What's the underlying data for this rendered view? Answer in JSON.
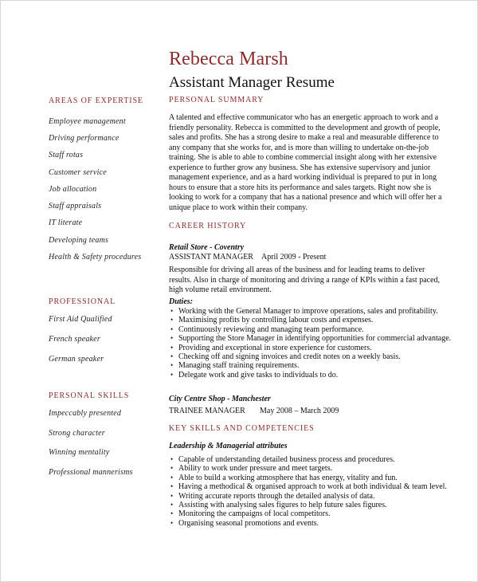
{
  "header": {
    "name": "Rebecca Marsh",
    "subtitle": "Assistant Manager Resume"
  },
  "sidebar": {
    "expertise": {
      "heading": "AREAS OF EXPERTISE",
      "items": [
        "Employee management",
        "Driving performance",
        "Staff rotas",
        "Customer service",
        "Job allocation",
        "Staff appraisals",
        "IT literate",
        "Developing teams",
        "Health & Safety procedures"
      ]
    },
    "professional": {
      "heading": "PROFESSIONAL",
      "items": [
        "First Aid Qualified",
        "French speaker",
        "German speaker"
      ]
    },
    "personal_skills": {
      "heading": "PERSONAL SKILLS",
      "items": [
        "Impeccably presented",
        "Strong character",
        "Winning mentality",
        "Professional mannerisms"
      ]
    }
  },
  "summary": {
    "heading": "PERSONAL SUMMARY",
    "text": "A talented and effective communicator who has an energetic approach to work and a friendly personality. Rebecca is committed to the development and growth of people, sales and profits. She has a strong desire to make a real and measurable difference to any company that she works for, and is more than willing to undertake on-the-job training. She is able to able to combine commercial insight along with her extensive experience to further grow any business. She has extensive supervisory and junior management experience, and as a hard working individual is prepared to put in long hours to ensure that a store hits its performance and sales targets. Right now she is looking to work for a company that has a national presence and which will offer her a unique place to work within their company."
  },
  "career": {
    "heading": "CAREER HISTORY",
    "jobs": [
      {
        "company": "Retail Store  - Coventry",
        "title": "ASSISTANT MANAGER",
        "dates": "April 2009 - Present",
        "description": "Responsible for driving all areas of the business and for leading teams to deliver results. Also in charge of monitoring and driving a range of KPIs within a fast paced, high volume retail environment.",
        "duties_label": "Duties:",
        "duties": [
          "Working with the General Manager to improve operations, sales and profitability.",
          "Maximising profits by controlling labour costs and expenses.",
          "Continuously reviewing and managing team performance.",
          "Supporting the Store Manager in identifying opportunities for commercial advantage.",
          "Providing and exceptional in store experience for customers.",
          "Checking off and signing invoices and credit notes on a weekly basis.",
          "Managing staff training requirements.",
          "Delegate work and give tasks to individuals to do."
        ]
      },
      {
        "company": "City Centre Shop - Manchester",
        "title": "TRAINEE MANAGER",
        "dates": "May 2008  – March 2009"
      }
    ]
  },
  "skills": {
    "heading": "KEY SKILLS AND COMPETENCIES",
    "subheading": "Leadership & Managerial attributes",
    "items": [
      "Capable of understanding detailed business process and procedures.",
      "Ability to work under pressure and meet targets.",
      "Able to build a working atmosphere that has energy, vitality and fun.",
      "Having a methodical & organised approach to work at both individual & team level.",
      "Writing accurate reports through the detailed analysis of data.",
      "Assisting with analysing sales figures to help future sales figures.",
      "Monitoring the campaigns of local competitors.",
      "Organising seasonal promotions and events."
    ]
  },
  "bullet_glyph": "•",
  "colors": {
    "accent": "#8b2c2c",
    "text": "#111111",
    "page_border": "#d6d6d6"
  }
}
